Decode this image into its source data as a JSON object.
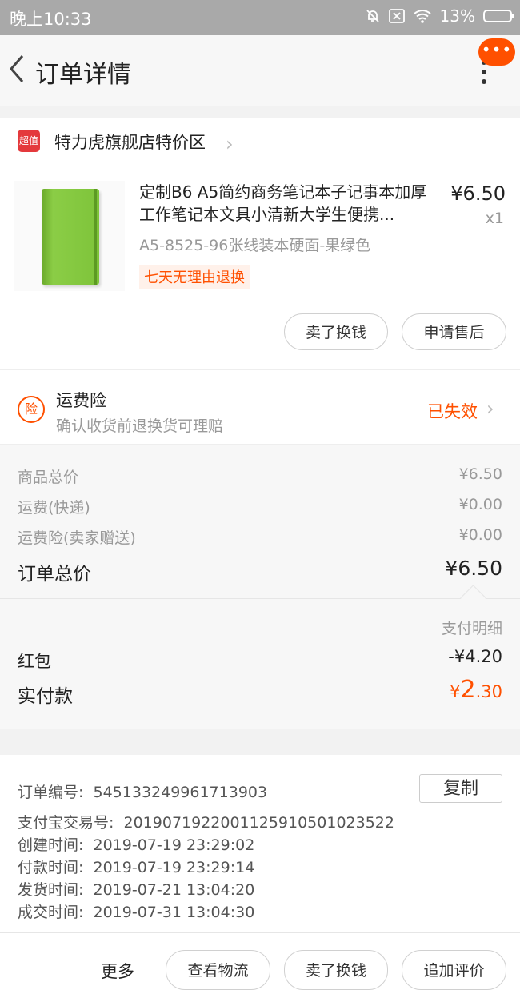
{
  "status_bar": {
    "time": "晚上10:33",
    "battery": "13%"
  },
  "header": {
    "title": "订单详情",
    "menu_badge": "•••"
  },
  "shop": {
    "logo_text": "超值",
    "name": "特力虎旗舰店特价区"
  },
  "product": {
    "title": "定制B6 A5简约商务笔记本子记事本加厚工作笔记本文具小清新大学生便携...",
    "price": "¥6.50",
    "qty": "x1",
    "spec": "A5-8525-96张线装本硬面-果绿色",
    "tag": "七天无理由退换",
    "image_color": "#7ec43a",
    "buttons": {
      "sell": "卖了换钱",
      "after_sale": "申请售后"
    }
  },
  "insurance": {
    "icon_text": "险",
    "title": "运费险",
    "subtitle": "确认收货前退换货可理赔",
    "status": "已失效"
  },
  "costs": {
    "items": [
      {
        "label": "商品总价",
        "value": "¥6.50"
      },
      {
        "label": "运费(快递)",
        "value": "¥0.00"
      },
      {
        "label": "运费险(卖家赠送)",
        "value": "¥0.00"
      }
    ],
    "total_label": "订单总价",
    "total_value": "¥6.50"
  },
  "payment": {
    "detail_label": "支付明细",
    "red_packet_label": "红包",
    "red_packet_value": "-¥4.20",
    "paid_label": "实付款",
    "paid_symbol": "¥",
    "paid_integer": "2",
    "paid_decimal": ".30"
  },
  "order_info": {
    "order_no_label": "订单编号:",
    "order_no": "545133249961713903",
    "copy_label": "复制",
    "alipay_label": "支付宝交易号:",
    "alipay_no": "2019071922001125910501023522",
    "created_label": "创建时间:",
    "created": "2019-07-19 23:29:02",
    "paid_label": "付款时间:",
    "paid": "2019-07-19 23:29:14",
    "shipped_label": "发货时间:",
    "shipped": "2019-07-21 13:04:20",
    "completed_label": "成交时间:",
    "completed": "2019-07-31 13:04:30"
  },
  "bottom_bar": {
    "more": "更多",
    "logistics": "查看物流",
    "sell": "卖了换钱",
    "review": "追加评价"
  },
  "colors": {
    "accent": "#ff5000"
  }
}
